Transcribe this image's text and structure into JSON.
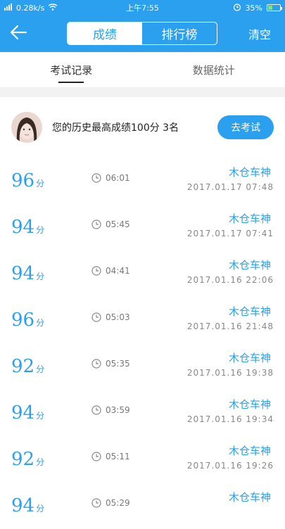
{
  "status_bar": {
    "network_speed": "0.28k/s",
    "time": "上午7:55",
    "battery": "35%",
    "battery_level": 0.35,
    "signal_icon": "signal-icon",
    "wifi_icon": "wifi-icon",
    "alarm_icon": "alarm-icon"
  },
  "header": {
    "back_icon": "arrow-left-icon",
    "segments": [
      "成绩",
      "排行榜"
    ],
    "active_segment": 0,
    "clear_label": "清空"
  },
  "tabs": {
    "items": [
      "考试记录",
      "数据统计"
    ],
    "active": 0
  },
  "summary": {
    "text": "您的历史最高成绩100分 3名",
    "button_label": "去考试"
  },
  "records": [
    {
      "score": "96",
      "unit": "分",
      "duration": "06:01",
      "user": "木仓车神",
      "datetime": "2017.01.17 07:48"
    },
    {
      "score": "94",
      "unit": "分",
      "duration": "05:45",
      "user": "木仓车神",
      "datetime": "2017.01.17 07:41"
    },
    {
      "score": "94",
      "unit": "分",
      "duration": "04:41",
      "user": "木仓车神",
      "datetime": "2017.01.16 22:06"
    },
    {
      "score": "96",
      "unit": "分",
      "duration": "05:03",
      "user": "木仓车神",
      "datetime": "2017.01.16 21:48"
    },
    {
      "score": "92",
      "unit": "分",
      "duration": "05:35",
      "user": "木仓车神",
      "datetime": "2017.01.16 19:38"
    },
    {
      "score": "94",
      "unit": "分",
      "duration": "03:59",
      "user": "木仓车神",
      "datetime": "2017.01.16 19:34"
    },
    {
      "score": "92",
      "unit": "分",
      "duration": "05:11",
      "user": "木仓车神",
      "datetime": "2017.01.16 19:26"
    },
    {
      "score": "94",
      "unit": "分",
      "duration": "05:29",
      "user": "木仓车神",
      "datetime": ""
    }
  ],
  "colors": {
    "accent": "#2aa0ef",
    "battery_fill": "#7ee37e"
  }
}
